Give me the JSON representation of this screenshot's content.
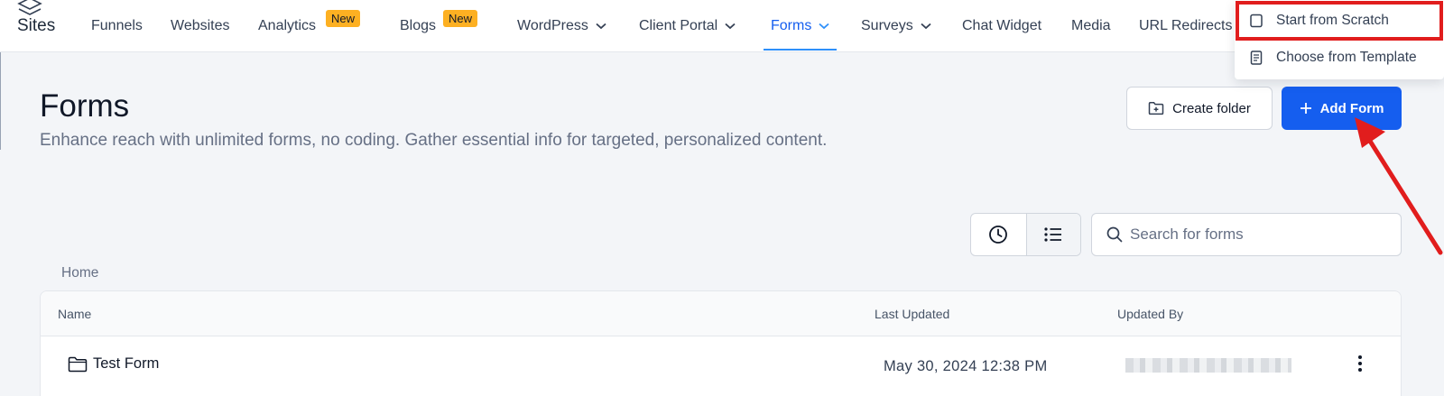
{
  "app": {
    "name": "Sites"
  },
  "nav": {
    "items": [
      {
        "label": "Funnels"
      },
      {
        "label": "Websites"
      },
      {
        "label": "Analytics",
        "badge": "New"
      },
      {
        "label": "Blogs",
        "badge": "New"
      },
      {
        "label": "WordPress"
      },
      {
        "label": "Client Portal"
      },
      {
        "label": "Forms",
        "active": true
      },
      {
        "label": "Surveys"
      },
      {
        "label": "Chat Widget"
      },
      {
        "label": "Media"
      },
      {
        "label": "URL Redirects"
      }
    ]
  },
  "header": {
    "title": "Forms",
    "subtitle": "Enhance reach with unlimited forms, no coding. Gather essential info for targeted, personalized content.",
    "create_folder_label": "Create folder",
    "add_form_label": "Add Form"
  },
  "dropdown": {
    "items": [
      {
        "label": "Start from Scratch",
        "icon": "blank-page-icon",
        "highlighted": true
      },
      {
        "label": "Choose from Template",
        "icon": "template-doc-icon"
      }
    ]
  },
  "toolbar": {
    "search_placeholder": "Search for forms"
  },
  "breadcrumb": {
    "home": "Home"
  },
  "table": {
    "columns": [
      "Name",
      "Last Updated",
      "Updated By"
    ],
    "rows": [
      {
        "name": "Test Form",
        "last_updated": "May 30, 2024 12:38 PM",
        "updated_by": ""
      }
    ]
  },
  "colors": {
    "accent": "#155eef",
    "annotation": "#e11d1d",
    "badge": "#fdb022"
  }
}
